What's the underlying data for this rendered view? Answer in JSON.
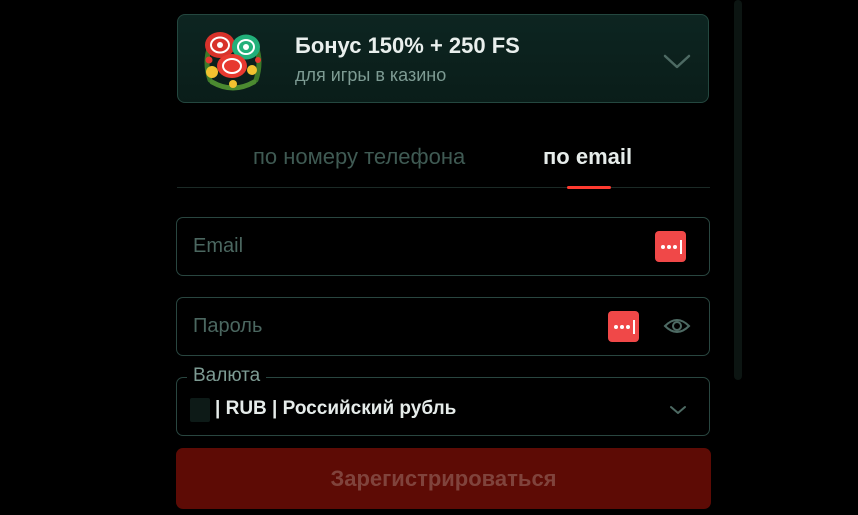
{
  "bonus": {
    "title": "Бонус 150% + 250 FS",
    "subtitle": "для игры в казино",
    "image_icon": "casino-chips-wreath-icon",
    "chevron_icon": "chevron-down-icon"
  },
  "tabs": {
    "items": [
      {
        "label": "по номеру телефона",
        "active": false
      },
      {
        "label": "по email",
        "active": true
      }
    ]
  },
  "form": {
    "email": {
      "placeholder": "Email",
      "value": "",
      "badge_icon": "password-manager-icon"
    },
    "password": {
      "placeholder": "Пароль",
      "value": "",
      "badge_icon": "password-manager-icon",
      "toggle_icon": "eye-icon"
    },
    "currency": {
      "legend": "Валюта",
      "value": "| RUB | Российский рубль",
      "flag_icon": "flag-icon",
      "chevron_icon": "chevron-down-icon"
    },
    "submit_label": "Зарегистрироваться"
  },
  "colors": {
    "background": "#000000",
    "accent": "#ff3b30",
    "card_border": "#24473f",
    "muted_text": "#7d9b93",
    "submit_bg": "#5d0b05",
    "password_badge": "#f04848"
  }
}
